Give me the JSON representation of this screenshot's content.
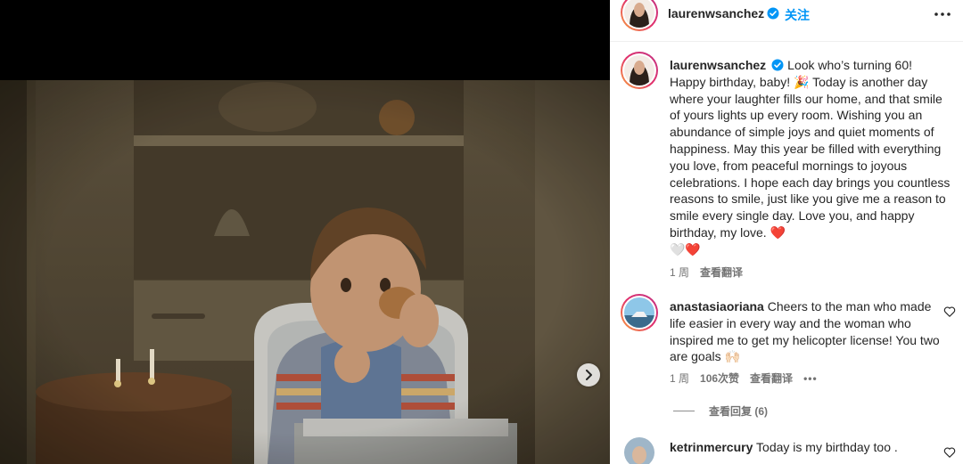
{
  "post": {
    "author": "laurenwsanchez",
    "follow_label": "关注"
  },
  "caption": {
    "username": "laurenwsanchez",
    "text": "Look who’s turning 60! Happy birthday, baby! 🎉 Today is another day where your laughter fills our home, and that smile of yours lights up every room. Wishing you an abundance of simple joys and quiet moments of happiness. May this year be filled with everything you love, from peaceful mornings to joyous celebrations. I hope each day brings you countless reasons to smile, just like you give me a reason to smile every single day. Love you, and happy birthday, my love. ❤️",
    "trailing_emoji": "🤍❤️",
    "age": "1 周",
    "translate_label": "查看翻译"
  },
  "comments": [
    {
      "username": "anastasiaoriana",
      "text": "Cheers to the man who made life easier in every way and the woman who inspired me to get my helicopter license! You two are goals 🙌🏻",
      "age": "1 周",
      "likes": "106次赞",
      "translate_label": "查看翻译",
      "more": "•••",
      "view_replies": "查看回复 (6)"
    },
    {
      "username": "ketrinmercury",
      "text": "Today is my birthday too ."
    }
  ],
  "icons": {
    "verified": "verified-badge-icon",
    "more": "more-options-icon",
    "next": "chevron-right-icon",
    "like": "heart-outline-icon"
  },
  "colors": {
    "link_blue": "#0095f6",
    "verified_blue": "#0095f6",
    "secondary_text": "#737373"
  }
}
